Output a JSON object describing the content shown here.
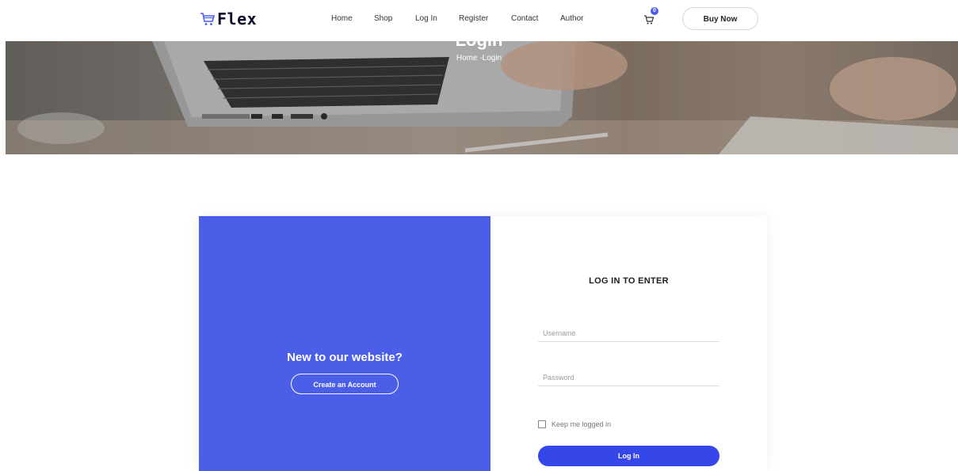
{
  "header": {
    "logo_text": "Flex",
    "nav": [
      "Home",
      "Shop",
      "Log In",
      "Register",
      "Contact",
      "Author"
    ],
    "cart_count": "0",
    "buy_now_label": "Buy Now"
  },
  "banner": {
    "title": "Login",
    "breadcrumb": "Home -Login"
  },
  "login_panel": {
    "new_title": "New to our website?",
    "create_account_label": "Create an Account"
  },
  "form": {
    "title": "LOG IN TO ENTER",
    "username_placeholder": "Username",
    "password_placeholder": "Password",
    "remember_label": "Keep me logged in",
    "submit_label": "Log In"
  },
  "colors": {
    "primary": "#4a5ee8",
    "button": "#3547e8",
    "logo": "#0b0b2b"
  }
}
